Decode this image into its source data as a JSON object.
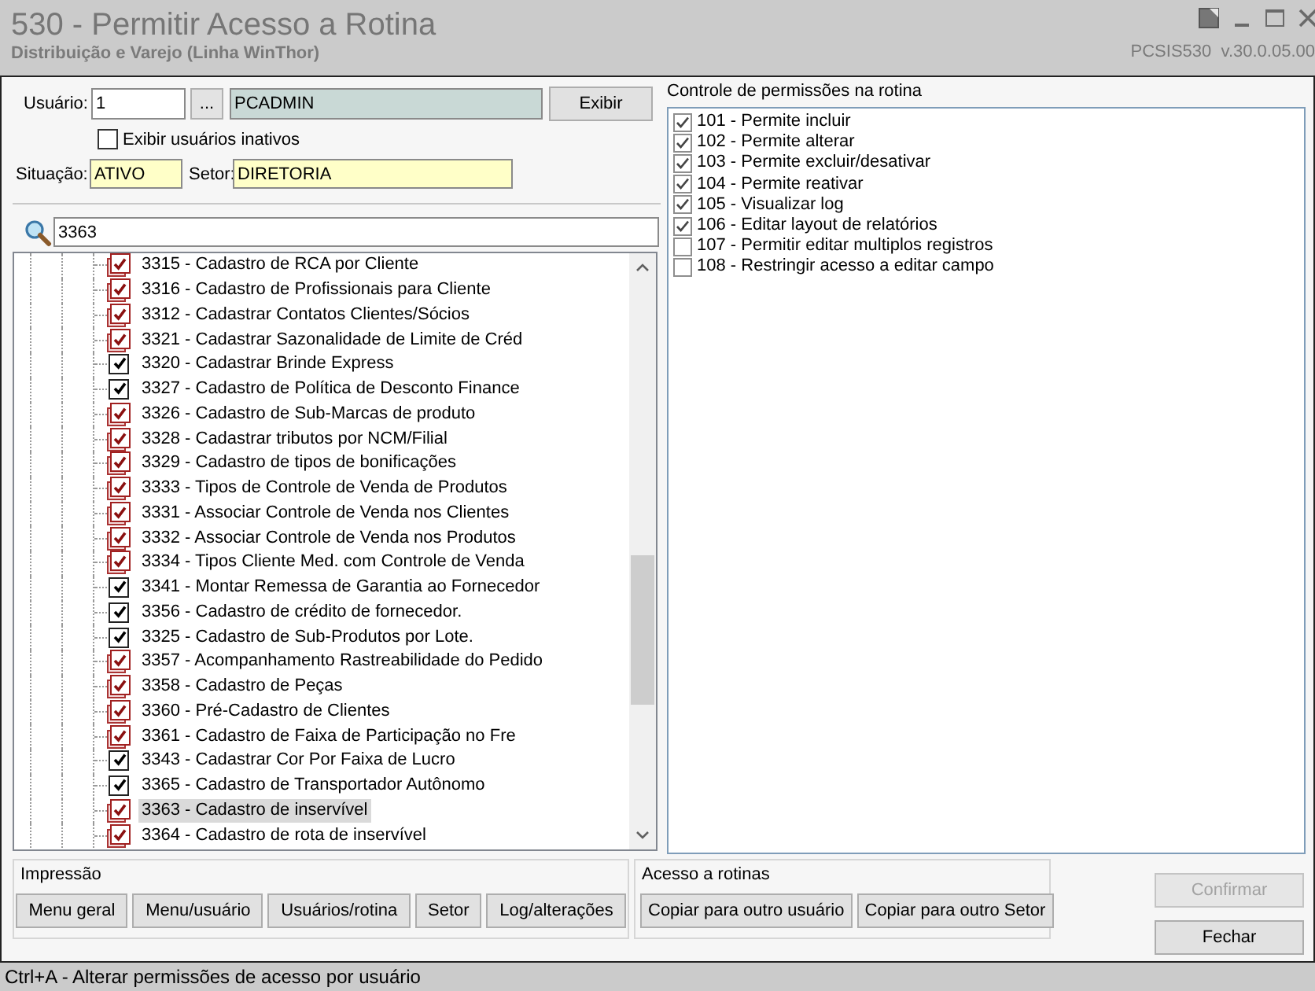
{
  "window": {
    "title": "530 - Permitir Acesso a Rotina",
    "subtitle": "Distribuição e Varejo (Linha WinThor)",
    "version": "PCSIS530  v.30.0.05.00"
  },
  "user_form": {
    "user_label": "Usuário:",
    "user_id": "1",
    "lookup_button": "...",
    "user_name": "PCADMIN",
    "show_button": "Exibir",
    "inactive_checkbox": {
      "label": "Exibir usuários inativos",
      "checked": false
    },
    "status_label": "Situação:",
    "status": "ATIVO",
    "sector_label": "Setor:",
    "sector": "DIRETORIA"
  },
  "search": {
    "value": "3363"
  },
  "routines": [
    {
      "label": "3315 - Cadastro de RCA por Cliente",
      "checked": true,
      "kind": "stacked",
      "selected": false
    },
    {
      "label": "3316 - Cadastro de Profissionais para Cliente",
      "checked": true,
      "kind": "stacked",
      "selected": false
    },
    {
      "label": "3312 - Cadastrar Contatos Clientes/Sócios",
      "checked": true,
      "kind": "stacked",
      "selected": false
    },
    {
      "label": "3321 - Cadastrar Sazonalidade de Limite de Créd",
      "checked": true,
      "kind": "stacked",
      "selected": false
    },
    {
      "label": "3320 - Cadastrar Brinde Express",
      "checked": true,
      "kind": "plain",
      "selected": false
    },
    {
      "label": "3327 - Cadastro de Política de Desconto Finance",
      "checked": true,
      "kind": "plain",
      "selected": false
    },
    {
      "label": "3326 - Cadastro de Sub-Marcas de produto",
      "checked": true,
      "kind": "stacked",
      "selected": false
    },
    {
      "label": "3328 - Cadastrar tributos por NCM/Filial",
      "checked": true,
      "kind": "stacked",
      "selected": false
    },
    {
      "label": "3329 - Cadastro de tipos de bonificações",
      "checked": true,
      "kind": "stacked",
      "selected": false
    },
    {
      "label": "3333 - Tipos de Controle de Venda de Produtos",
      "checked": true,
      "kind": "stacked",
      "selected": false
    },
    {
      "label": "3331 - Associar Controle de Venda nos Clientes",
      "checked": true,
      "kind": "stacked",
      "selected": false
    },
    {
      "label": "3332 - Associar Controle de Venda nos Produtos",
      "checked": true,
      "kind": "stacked",
      "selected": false
    },
    {
      "label": "3334 - Tipos Cliente Med. com Controle de Venda",
      "checked": true,
      "kind": "stacked",
      "selected": false
    },
    {
      "label": "3341 - Montar Remessa de Garantia ao Fornecedor",
      "checked": true,
      "kind": "plain",
      "selected": false
    },
    {
      "label": "3356 - Cadastro de crédito de fornecedor.",
      "checked": true,
      "kind": "plain",
      "selected": false
    },
    {
      "label": "3325 - Cadastro de Sub-Produtos por Lote.",
      "checked": true,
      "kind": "plain",
      "selected": false
    },
    {
      "label": "3357 - Acompanhamento Rastreabilidade do Pedido",
      "checked": true,
      "kind": "stacked",
      "selected": false
    },
    {
      "label": "3358 - Cadastro de Peças",
      "checked": true,
      "kind": "stacked",
      "selected": false
    },
    {
      "label": "3360 - Pré-Cadastro de Clientes",
      "checked": true,
      "kind": "stacked",
      "selected": false
    },
    {
      "label": "3361 - Cadastro de Faixa de Participação no Fre",
      "checked": true,
      "kind": "stacked",
      "selected": false
    },
    {
      "label": "3343 - Cadastrar Cor Por Faixa de Lucro",
      "checked": true,
      "kind": "plain",
      "selected": false
    },
    {
      "label": "3365 - Cadastro de Transportador Autônomo",
      "checked": true,
      "kind": "plain",
      "selected": false
    },
    {
      "label": "3363 - Cadastro de inservível",
      "checked": true,
      "kind": "stacked",
      "selected": true
    },
    {
      "label": "3364 - Cadastro de rota de inservível",
      "checked": true,
      "kind": "stacked",
      "selected": false
    }
  ],
  "permissions": {
    "title": "Controle de permissões na rotina",
    "items": [
      {
        "label": "101 - Permite incluir",
        "checked": true
      },
      {
        "label": "102 - Permite alterar",
        "checked": true
      },
      {
        "label": "103 - Permite excluir/desativar",
        "checked": true
      },
      {
        "label": "104 - Permite reativar",
        "checked": true
      },
      {
        "label": "105 - Visualizar log",
        "checked": true
      },
      {
        "label": "106 - Editar layout de relatórios",
        "checked": true
      },
      {
        "label": "107 - Permitir editar multiplos registros",
        "checked": false
      },
      {
        "label": "108 - Restringir acesso a editar campo",
        "checked": false
      }
    ]
  },
  "print_group": {
    "title": "Impressão",
    "buttons": [
      "Menu geral",
      "Menu/usuário",
      "Usuários/rotina",
      "Setor",
      "Log/alterações"
    ]
  },
  "access_group": {
    "title": "Acesso a rotinas",
    "buttons": [
      "Copiar para outro usuário",
      "Copiar para outro Setor"
    ]
  },
  "actions": [
    {
      "label": "Confirmar",
      "disabled": true
    },
    {
      "label": "Fechar",
      "disabled": false
    }
  ],
  "status_bar": "Ctrl+A - Alterar permissões de acesso por usuário"
}
